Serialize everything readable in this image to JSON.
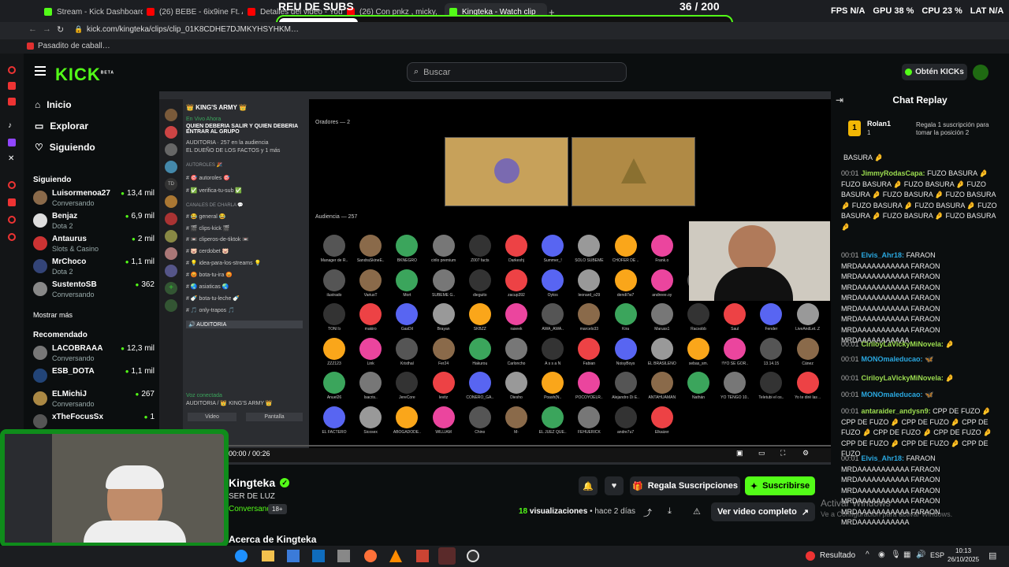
{
  "browser": {
    "tabs": [
      {
        "label": "Stream - Kick Dashboard",
        "color": "#53fc18"
      },
      {
        "label": "(26) BEBE - 6ix9ine Ft. A",
        "color": "#ff0000"
      },
      {
        "label": "Detalles del video - You",
        "color": "#ff0000"
      },
      {
        "label": "(26) Con pnkz , micky, C",
        "color": "#ff0000"
      },
      {
        "label": "Kingteka - Watch clip",
        "color": "#53fc18"
      }
    ],
    "url": "kick.com/kingteka/clips/clip_01K8CDHE7DJMKYHSYHKM…",
    "bookmark": "Pasadito de caball…",
    "overlay_title": "REU DE SUBS",
    "overlay_count": "36  / 200",
    "stats": {
      "fps_label": "FPS",
      "fps": "N/A",
      "gpu_label": "GPU",
      "gpu": "38 %",
      "cpu_label": "CPU",
      "cpu": "23 %",
      "lat_label": "LAT",
      "lat": "N/A"
    }
  },
  "header": {
    "logo": "KICK",
    "logo_sup": "BETA",
    "search_placeholder": "Buscar",
    "get_kicks": "Obtén KICKs"
  },
  "sidebar": {
    "nav": [
      {
        "label": "Inicio",
        "icon": "home-icon"
      },
      {
        "label": "Explorar",
        "icon": "explore-icon"
      },
      {
        "label": "Siguiendo",
        "icon": "heart-icon"
      }
    ],
    "following_title": "Siguiendo",
    "following": [
      {
        "name": "Luisormenoa27",
        "game": "Conversando",
        "viewers": "13,4 mil",
        "color": "#8a6a4a"
      },
      {
        "name": "Benjaz",
        "game": "Dota 2",
        "viewers": "6,9 mil",
        "color": "#ddd"
      },
      {
        "name": "Antaurus",
        "game": "Slots & Casino",
        "viewers": "2 mil",
        "color": "#c33"
      },
      {
        "name": "MrChoco",
        "game": "Dota 2",
        "viewers": "1,1 mil",
        "color": "#347"
      },
      {
        "name": "SustentoSB",
        "game": "Conversando",
        "viewers": "362",
        "color": "#888"
      }
    ],
    "show_more": "Mostrar más",
    "recommended_title": "Recomendado",
    "recommended": [
      {
        "name": "LACOBRAAA",
        "game": "Conversando",
        "viewers": "12,3 mil",
        "color": "#777"
      },
      {
        "name": "ESB_DOTA",
        "game": "",
        "viewers": "1,1 mil",
        "color": "#247"
      },
      {
        "name": "ELMichiJ",
        "game": "Conversando",
        "viewers": "267",
        "color": "#a84"
      },
      {
        "name": "xTheFocusSx",
        "game": "",
        "viewers": "1",
        "color": "#555"
      }
    ]
  },
  "discord": {
    "server_name": "👑 KING'S ARMY 👑",
    "event_label": "En Vivo Ahora",
    "event_title": "QUIEN DEBERIA SALIR Y QUIEN DEBERIA ENTRAR AL GRUPO",
    "event_sub": "AUDITORIA · 257 en la audiencia",
    "event_owner": "EL DUEÑO DE LOS FACTOS y 1 más",
    "channels": [
      "AUTOROLES 🎉",
      "# 🎯 autoroles 🎯",
      "# ✅ verifica-tu-sub ✅",
      "CANALES DE CHARLA 💬",
      "# 😂 general 😂",
      "# 🎬 clips-kick 🎬",
      "# 📼 cliperos-de-tiktok 📼",
      "# 🐷 cerdobet 🐷",
      "# 💡 idea-para-los-streams 💡",
      "# 😡 bota-tu-ira 😡",
      "# 🌏 asiaticas 🌏",
      "# 🍼 bota-tu-leche 🍼",
      "# 🎵 only-trapos 🎵",
      "🔊 AUDITORIA"
    ],
    "voice_connected": "Voz conectada",
    "voice_sub": "AUDITORIA / 👑 KING'S ARMY 👑",
    "voice_video": "Video",
    "voice_screen": "Pantalla",
    "speakers_label": "Oradores — 2",
    "audience_label": "Audiencia — 257",
    "audience": [
      "Manager de R..",
      "SandraSkineE..",
      "BKNEGRO",
      "cirilo premium",
      "Z007 facts",
      "Darkeshj",
      "Summer_!",
      "SOLO SUBEME",
      "CHOFER DE ..",
      "Frank.o",
      "ilustrado",
      "VariusT",
      "Mort",
      "SUBEME G..",
      "dieguito",
      "zacup392",
      "Oytos",
      "leonard_o29",
      "dendi7w7",
      "andreee.oy",
      "gOn",
      "Rayzennnr",
      "Tiobob",
      "bjeyerech",
      "TONI b",
      "makiro",
      "GasDil",
      "Brayan",
      "SKBZZ",
      "raseek",
      "AWA_AWA..",
      "marcelo33",
      "Kira",
      "Maruss1",
      "Racsobb",
      "Saul",
      "Fender",
      "LiveAndLet..Z",
      "ZZZ123",
      "Link",
      "Kristhal",
      "Fer24",
      "Hakurou",
      "Carloncho",
      "A s s a N",
      "Fabian",
      "NoisyBoys",
      "EL BRASILEÑO",
      "sebas_sm.",
      "!!YO SE GOR..",
      "13.14.15",
      "Cánez",
      "Anuel26",
      "Isacris..",
      "JereCore",
      "levitz",
      "CONERO_GA..",
      "Diesho",
      "Poash(N..",
      "POCOYOELR..",
      "Alejandro Di E..",
      "ANTAHUAMAN",
      "Nathán",
      "YO TENGO 10..",
      "Teletubi el os..",
      "Yo te diré las ..",
      "EL FACTERO",
      "Sicosex",
      "ABOGADODE..",
      "WILLIAM",
      "Chino",
      "M-",
      "EL JUEZ QUE..",
      "FEHUERICK",
      "andre7u7",
      "Elkaizer"
    ]
  },
  "player": {
    "time": "00:00 / 00:26"
  },
  "channel": {
    "name": "Kingteka",
    "title": "SER DE LUZ",
    "category": "Conversando",
    "badge": "18+",
    "tab": "Acerca de Kingteka",
    "gift_subs": "Regala Suscripciones",
    "subscribe": "Suscribirse",
    "views": "18",
    "views_label": "visualizaciones",
    "ago": "• hace 2 días",
    "watch_full": "Ver video completo"
  },
  "chat": {
    "title": "Chat Replay",
    "pinned_user": "Rolan1",
    "pinned_count": "1",
    "pinned_text": "Regala 1 suscripción para tomar la posición 2",
    "messages": [
      {
        "time": "",
        "user": "",
        "color": "#e8e8e8",
        "text": "BASURA 🤌"
      },
      {
        "time": "00:01",
        "user": "JimmyRodasCapa:",
        "color": "#9bdc4f",
        "text": "FUZO BASURA 🤌 FUZO BASURA 🤌 FUZO BASURA 🤌 FUZO BASURA 🤌 FUZO BASURA 🤌 FUZO BASURA 🤌 FUZO BASURA 🤌 FUZO BASURA 🤌 FUZO BASURA 🤌 FUZO BASURA 🤌 FUZO BASURA 🤌"
      },
      {
        "time": "00:01",
        "user": "Elvis_Ahr18:",
        "color": "#2aa8e0",
        "text": "FARAON MRDAAAAAAAAAAA FARAON MRDAAAAAAAAAAA FARAON MRDAAAAAAAAAAA FARAON MRDAAAAAAAAAAA FARAON MRDAAAAAAAAAAA FARAON MRDAAAAAAAAAAA FARAON MRDAAAAAAAAAAA FARAON MRDAAAAAAAAAAA"
      },
      {
        "time": "00:01",
        "user": "CiriloyLaVickyMiNovela:",
        "color": "#9bdc4f",
        "text": "🤌"
      },
      {
        "time": "00:01",
        "user": "MONOmaleducao:",
        "color": "#2aa8e0",
        "text": "🦋"
      },
      {
        "time": "00:01",
        "user": "CiriloyLaVickyMiNovela:",
        "color": "#9bdc4f",
        "text": "🤌"
      },
      {
        "time": "00:01",
        "user": "MONOmaleducao:",
        "color": "#2aa8e0",
        "text": "🦋"
      },
      {
        "time": "00:01",
        "user": "antaraider_andysn9:",
        "color": "#9bdc4f",
        "text": "CPP DE FUZO 🤌 CPP DE FUZO 🤌 CPP DE FUZO 🤌 CPP DE FUZO 🤌 CPP DE FUZO 🤌 CPP DE FUZO 🤌 CPP DE FUZO 🤌 CPP DE FUZO 🤌 CPP DE FUZO"
      },
      {
        "time": "00:01",
        "user": "Elvis_Ahr18:",
        "color": "#2aa8e0",
        "text": "FARAON MRDAAAAAAAAAAA FARAON MRDAAAAAAAAAAA FARAON MRDAAAAAAAAAAA FARAON MRDAAAAAAAAAAA FARAON MRDAAAAAAAAAAA FARAON MRDAAAAAAAAAAA"
      }
    ]
  },
  "watermark": {
    "line1": "Activar Windows",
    "line2": "Ve a Configuración para activar Windows."
  },
  "taskbar": {
    "result": "Resultado",
    "lang": "ESP",
    "time": "10:13",
    "date": "26/10/2025"
  },
  "colors": {
    "kick_green": "#53fc18",
    "bg": "#0b0e0f",
    "discord_bg": "#2b2d31"
  }
}
